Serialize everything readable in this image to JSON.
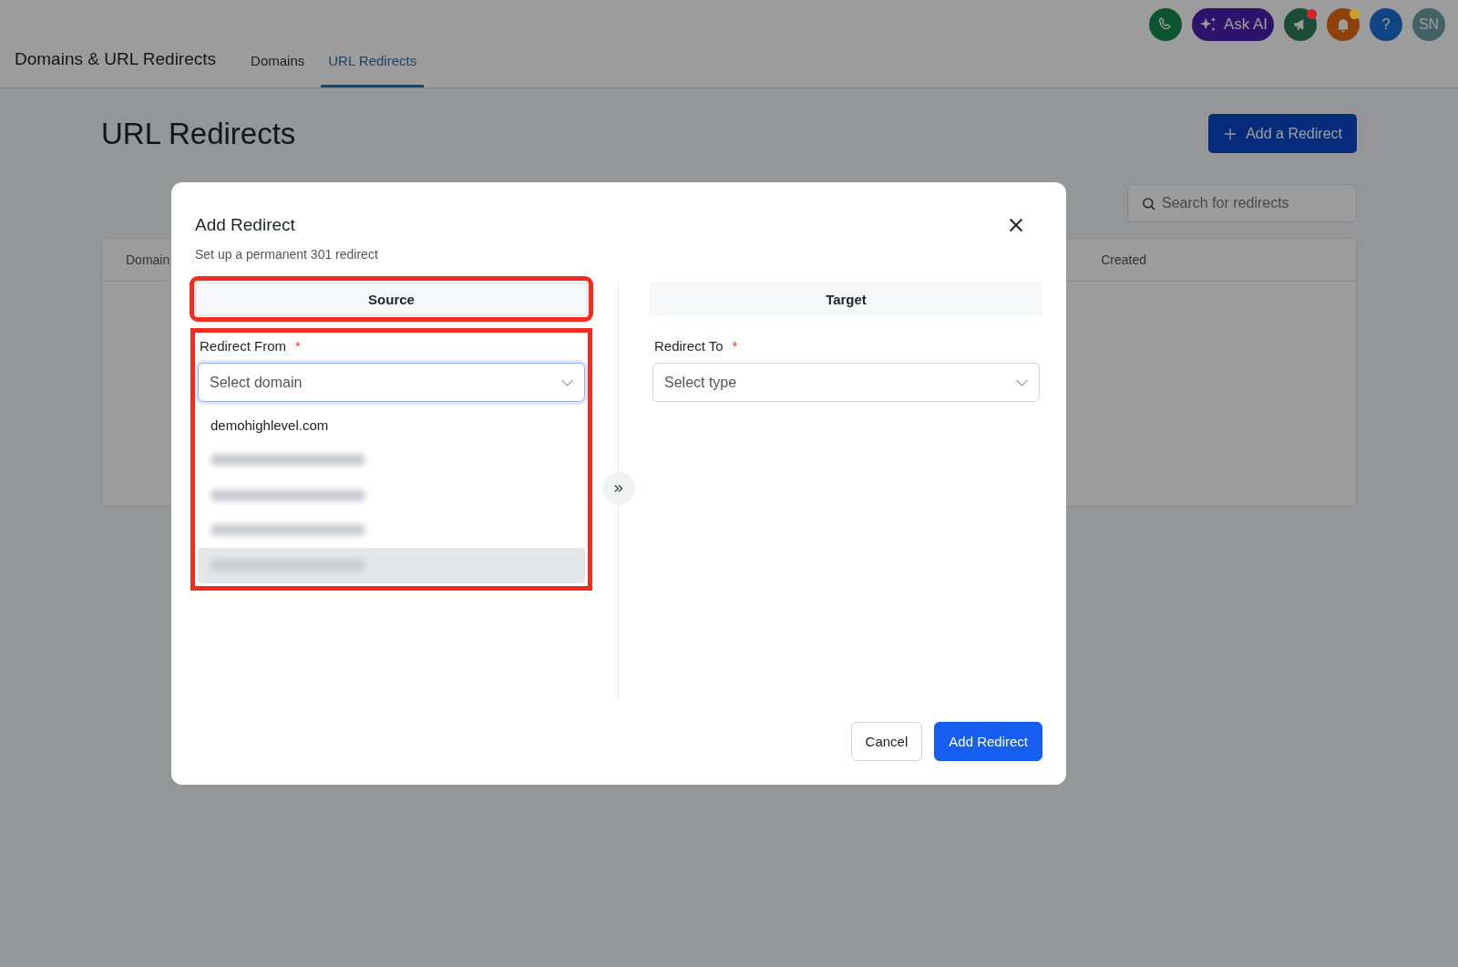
{
  "header": {
    "title": "Domains & URL Redirects",
    "tabs": [
      {
        "label": "Domains",
        "selected": false
      },
      {
        "label": "URL Redirects",
        "selected": true
      }
    ],
    "actions": [
      {
        "kind": "phone"
      },
      {
        "kind": "ask_ai",
        "label": "Ask AI"
      },
      {
        "kind": "megaphone",
        "color": "#d0282a"
      },
      {
        "kind": "bell",
        "color": "#c9a22b"
      },
      {
        "kind": "help",
        "label": "?"
      },
      {
        "kind": "avatar",
        "label": "SN"
      }
    ]
  },
  "page": {
    "title": "URL Redirects",
    "add_button": "Add a Redirect",
    "search": {
      "placeholder": "Search for redirects"
    },
    "table": {
      "columns": [
        "Domain",
        "Created"
      ]
    }
  },
  "modal": {
    "title": "Add Redirect",
    "subtitle": "Set up a permanent 301 redirect",
    "source": {
      "title": "Source",
      "highlighted": true,
      "field": {
        "label": "Redirect From",
        "required_mark": "*",
        "placeholder": "Select domain",
        "focused": true,
        "highlighted": true,
        "options": [
          {
            "label": "demohighlevel.com",
            "redacted": false,
            "hovered": false
          },
          {
            "redacted": true,
            "hovered": false
          },
          {
            "redacted": true,
            "hovered": false
          },
          {
            "redacted": true,
            "hovered": false
          },
          {
            "redacted": true,
            "hovered": true
          }
        ]
      }
    },
    "target": {
      "title": "Target",
      "highlighted": false,
      "field": {
        "label": "Redirect To",
        "required_mark": "*",
        "placeholder": "Select type",
        "focused": false,
        "highlighted": false
      }
    },
    "buttons": [
      {
        "label": "Cancel",
        "kind": "secondary"
      },
      {
        "label": "Add Redirect",
        "kind": "primary"
      }
    ]
  }
}
